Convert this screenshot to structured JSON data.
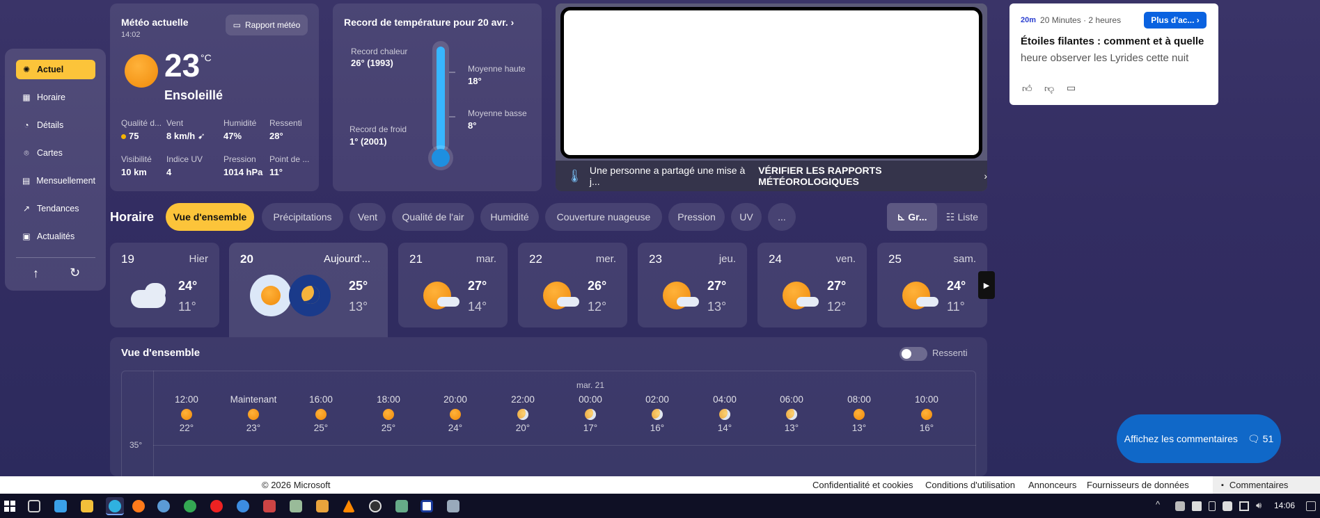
{
  "sidebar": {
    "items": [
      {
        "label": "Actuel",
        "icon": "sun-icon"
      },
      {
        "label": "Horaire",
        "icon": "clock-grid-icon"
      },
      {
        "label": "Détails",
        "icon": "pie-icon"
      },
      {
        "label": "Cartes",
        "icon": "map-pin-icon"
      },
      {
        "label": "Mensuellement",
        "icon": "calendar-icon"
      },
      {
        "label": "Tendances",
        "icon": "trend-icon"
      },
      {
        "label": "Actualités",
        "icon": "news-icon"
      }
    ],
    "up_icon": "↑",
    "refresh_icon": "↻"
  },
  "current": {
    "title": "Météo actuelle",
    "time": "14:02",
    "report_button": "Rapport météo",
    "temp": "23",
    "unit": "°C",
    "condition": "Ensoleillé",
    "stats": [
      {
        "label": "Qualité d...",
        "value": "75"
      },
      {
        "label": "Vent",
        "value": "8 km/h"
      },
      {
        "label": "Humidité",
        "value": "47%"
      },
      {
        "label": "Ressenti",
        "value": "28°"
      },
      {
        "label": "Visibilité",
        "value": "10 km"
      },
      {
        "label": "Indice UV",
        "value": "4"
      },
      {
        "label": "Pression",
        "value": "1014 hPa"
      },
      {
        "label": "Point de ...",
        "value": "11°"
      }
    ]
  },
  "record": {
    "title": "Record de température pour 20 avr.",
    "record_heat_label": "Record chaleur",
    "record_heat_value": "26° (1993)",
    "record_cold_label": "Record de froid",
    "record_cold_value": "1° (2001)",
    "avg_high_label": "Moyenne haute",
    "avg_high_value": "18°",
    "avg_low_label": "Moyenne basse",
    "avg_low_value": "8°"
  },
  "map": {
    "shared_text": "Une personne a partagé une mise à j...",
    "verify_link": "VÉRIFIER LES RAPPORTS MÉTÉOROLOGIQUES"
  },
  "news": {
    "source": "20 Minutes · 2 heures",
    "more_button": "Plus d'ac...",
    "headline_line1": "Étoiles filantes : comment et à quelle",
    "headline_line2": "heure observer les Lyrides cette nuit"
  },
  "hourly": {
    "title": "Horaire",
    "tabs": [
      "Vue d'ensemble",
      "Précipitations",
      "Vent",
      "Qualité de l'air",
      "Humidité",
      "Couverture nuageuse",
      "Pression",
      "UV",
      "..."
    ],
    "view_graph": "Gr...",
    "view_list": "Liste"
  },
  "days": [
    {
      "num": "19",
      "name": "Hier",
      "hi": "24°",
      "lo": "11°"
    },
    {
      "num": "20",
      "name": "Aujourd'...",
      "hi": "25°",
      "lo": "13°"
    },
    {
      "num": "21",
      "name": "mar.",
      "hi": "27°",
      "lo": "14°"
    },
    {
      "num": "22",
      "name": "mer.",
      "hi": "26°",
      "lo": "12°"
    },
    {
      "num": "23",
      "name": "jeu.",
      "hi": "27°",
      "lo": "13°"
    },
    {
      "num": "24",
      "name": "ven.",
      "hi": "27°",
      "lo": "12°"
    },
    {
      "num": "25",
      "name": "sam.",
      "hi": "24°",
      "lo": "11°"
    }
  ],
  "overview": {
    "title": "Vue d'ensemble",
    "toggle_label": "Ressenti",
    "date_marker": "mar. 21",
    "y_label": "35°",
    "hours": [
      {
        "t": "12:00",
        "v": "22°",
        "icon": "sun-cloud"
      },
      {
        "t": "Maintenant",
        "v": "23°",
        "icon": "sun"
      },
      {
        "t": "16:00",
        "v": "25°",
        "icon": "sun"
      },
      {
        "t": "18:00",
        "v": "25°",
        "icon": "sun-cloud"
      },
      {
        "t": "20:00",
        "v": "24°",
        "icon": "sun-cloud"
      },
      {
        "t": "22:00",
        "v": "20°",
        "icon": "moon-cloud"
      },
      {
        "t": "00:00",
        "v": "17°",
        "icon": "moon-cloud"
      },
      {
        "t": "02:00",
        "v": "16°",
        "icon": "moon-cloud"
      },
      {
        "t": "04:00",
        "v": "14°",
        "icon": "moon-cloud"
      },
      {
        "t": "06:00",
        "v": "13°",
        "icon": "moon-cloud"
      },
      {
        "t": "08:00",
        "v": "13°",
        "icon": "sun-cloud"
      },
      {
        "t": "10:00",
        "v": "16°",
        "icon": "sun-cloud"
      }
    ]
  },
  "comments_button": {
    "label": "Affichez les commentaires",
    "count": "51"
  },
  "footer": {
    "copyright": "© 2026 Microsoft",
    "links": [
      "Confidentialité et cookies",
      "Conditions d'utilisation",
      "Annonceurs",
      "Fournisseurs de données"
    ],
    "comments_tab": "Commentaires"
  },
  "taskbar": {
    "clock": "14:06"
  }
}
